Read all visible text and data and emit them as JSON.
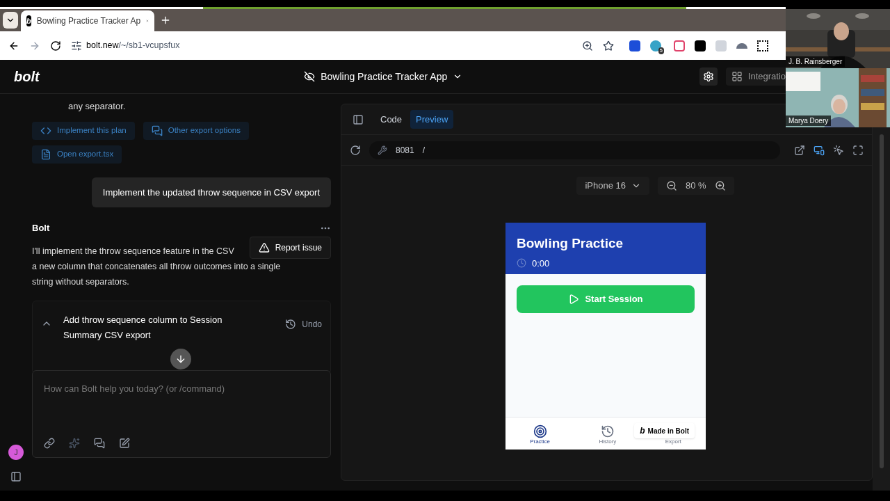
{
  "browser": {
    "tab": {
      "title": "Bowling Practice Tracker Ap",
      "favicon": "b",
      "selected": true
    },
    "url_host": "bolt.new",
    "url_path": "/~/sb1-vcupsfux",
    "forward_disabled": true,
    "extension_badge": "5"
  },
  "app": {
    "logo": "bolt",
    "project_title": "Bowling Practice Tracker App",
    "integrations": "Integratio"
  },
  "chat": {
    "previous_text": "any separator.",
    "plan_actions": [
      {
        "kind": "code",
        "label": "Implement this plan"
      },
      {
        "kind": "chat",
        "label": "Other export options"
      },
      {
        "kind": "file",
        "label": "Open export.tsx"
      }
    ],
    "user_message": "Implement the updated throw sequence in CSV export",
    "assistant_name": "Bolt",
    "assistant_lines": [
      "I'll implement the throw sequence feature in the CSV",
      "a new column that concatenates all throw outcomes into a single",
      "string without separators."
    ],
    "popup": "Report issue",
    "action_card": {
      "title": "Add throw sequence column to Session Summary CSV export",
      "expanded": true,
      "undo": "Undo"
    },
    "input_placeholder": "How can Bolt help you today? (or /command)",
    "avatar": "J"
  },
  "preview": {
    "tabs": [
      {
        "label": "Code",
        "selected": false
      },
      {
        "label": "Preview",
        "selected": true
      }
    ],
    "port": "8081",
    "path": "/",
    "device": "iPhone 16",
    "zoom": "80 %",
    "phone": {
      "title": "Bowling Practice",
      "timer": "0:00",
      "start_button": "Start Session",
      "nav": [
        {
          "kind": "target",
          "label": "Practice",
          "selected": true
        },
        {
          "kind": "history",
          "label": "History",
          "selected": false
        },
        {
          "kind": "export",
          "label": "Export",
          "selected": false
        }
      ],
      "badge_logo": "b",
      "badge": "Made in Bolt"
    }
  },
  "call": {
    "participants": [
      {
        "name": "J. B. Rainsberger"
      },
      {
        "name": "Marya Doery"
      }
    ]
  }
}
